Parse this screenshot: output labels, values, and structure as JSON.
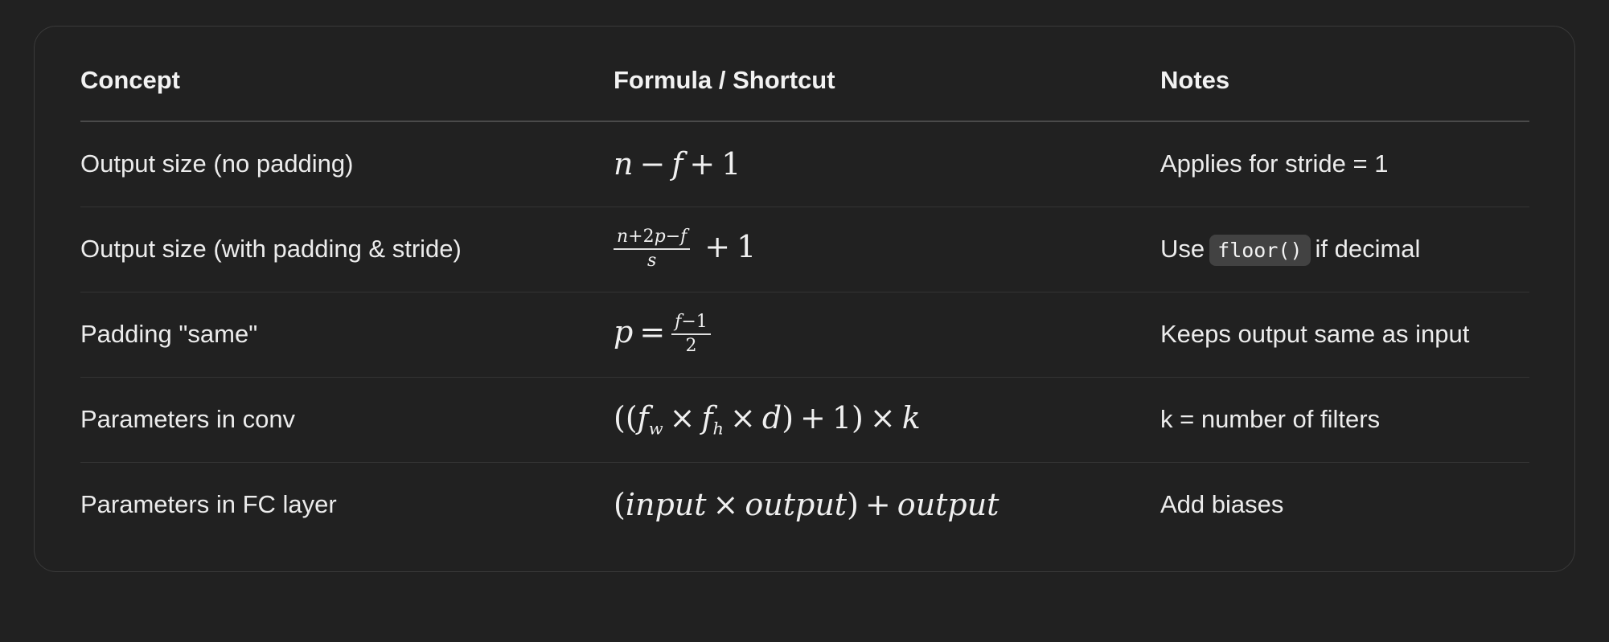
{
  "table": {
    "headers": [
      "Concept",
      "Formula / Shortcut",
      "Notes"
    ],
    "rows": [
      {
        "concept": "Output size (no padding)",
        "formula": "n − f + 1",
        "note": "Applies for stride = 1"
      },
      {
        "concept": "Output size (with padding & stride)",
        "formula": "(n+2p−f)/s + 1",
        "note_prefix": "Use",
        "note_code": "floor()",
        "note_suffix": "if decimal"
      },
      {
        "concept": "Padding \"same\"",
        "formula": "p = (f−1)/2",
        "note": "Keeps output same as input"
      },
      {
        "concept": "Parameters in conv",
        "formula": "((f_w × f_h × d) + 1) × k",
        "note": "k = number of filters"
      },
      {
        "concept": "Parameters in FC layer",
        "formula": "(input × output) + output",
        "note": "Add biases"
      }
    ]
  },
  "colors": {
    "background": "#212121",
    "card_border": "#3a3a3a",
    "row_divider": "#343434",
    "header_divider": "#4a4a4a",
    "code_background": "#424242",
    "text": "#ececec"
  }
}
